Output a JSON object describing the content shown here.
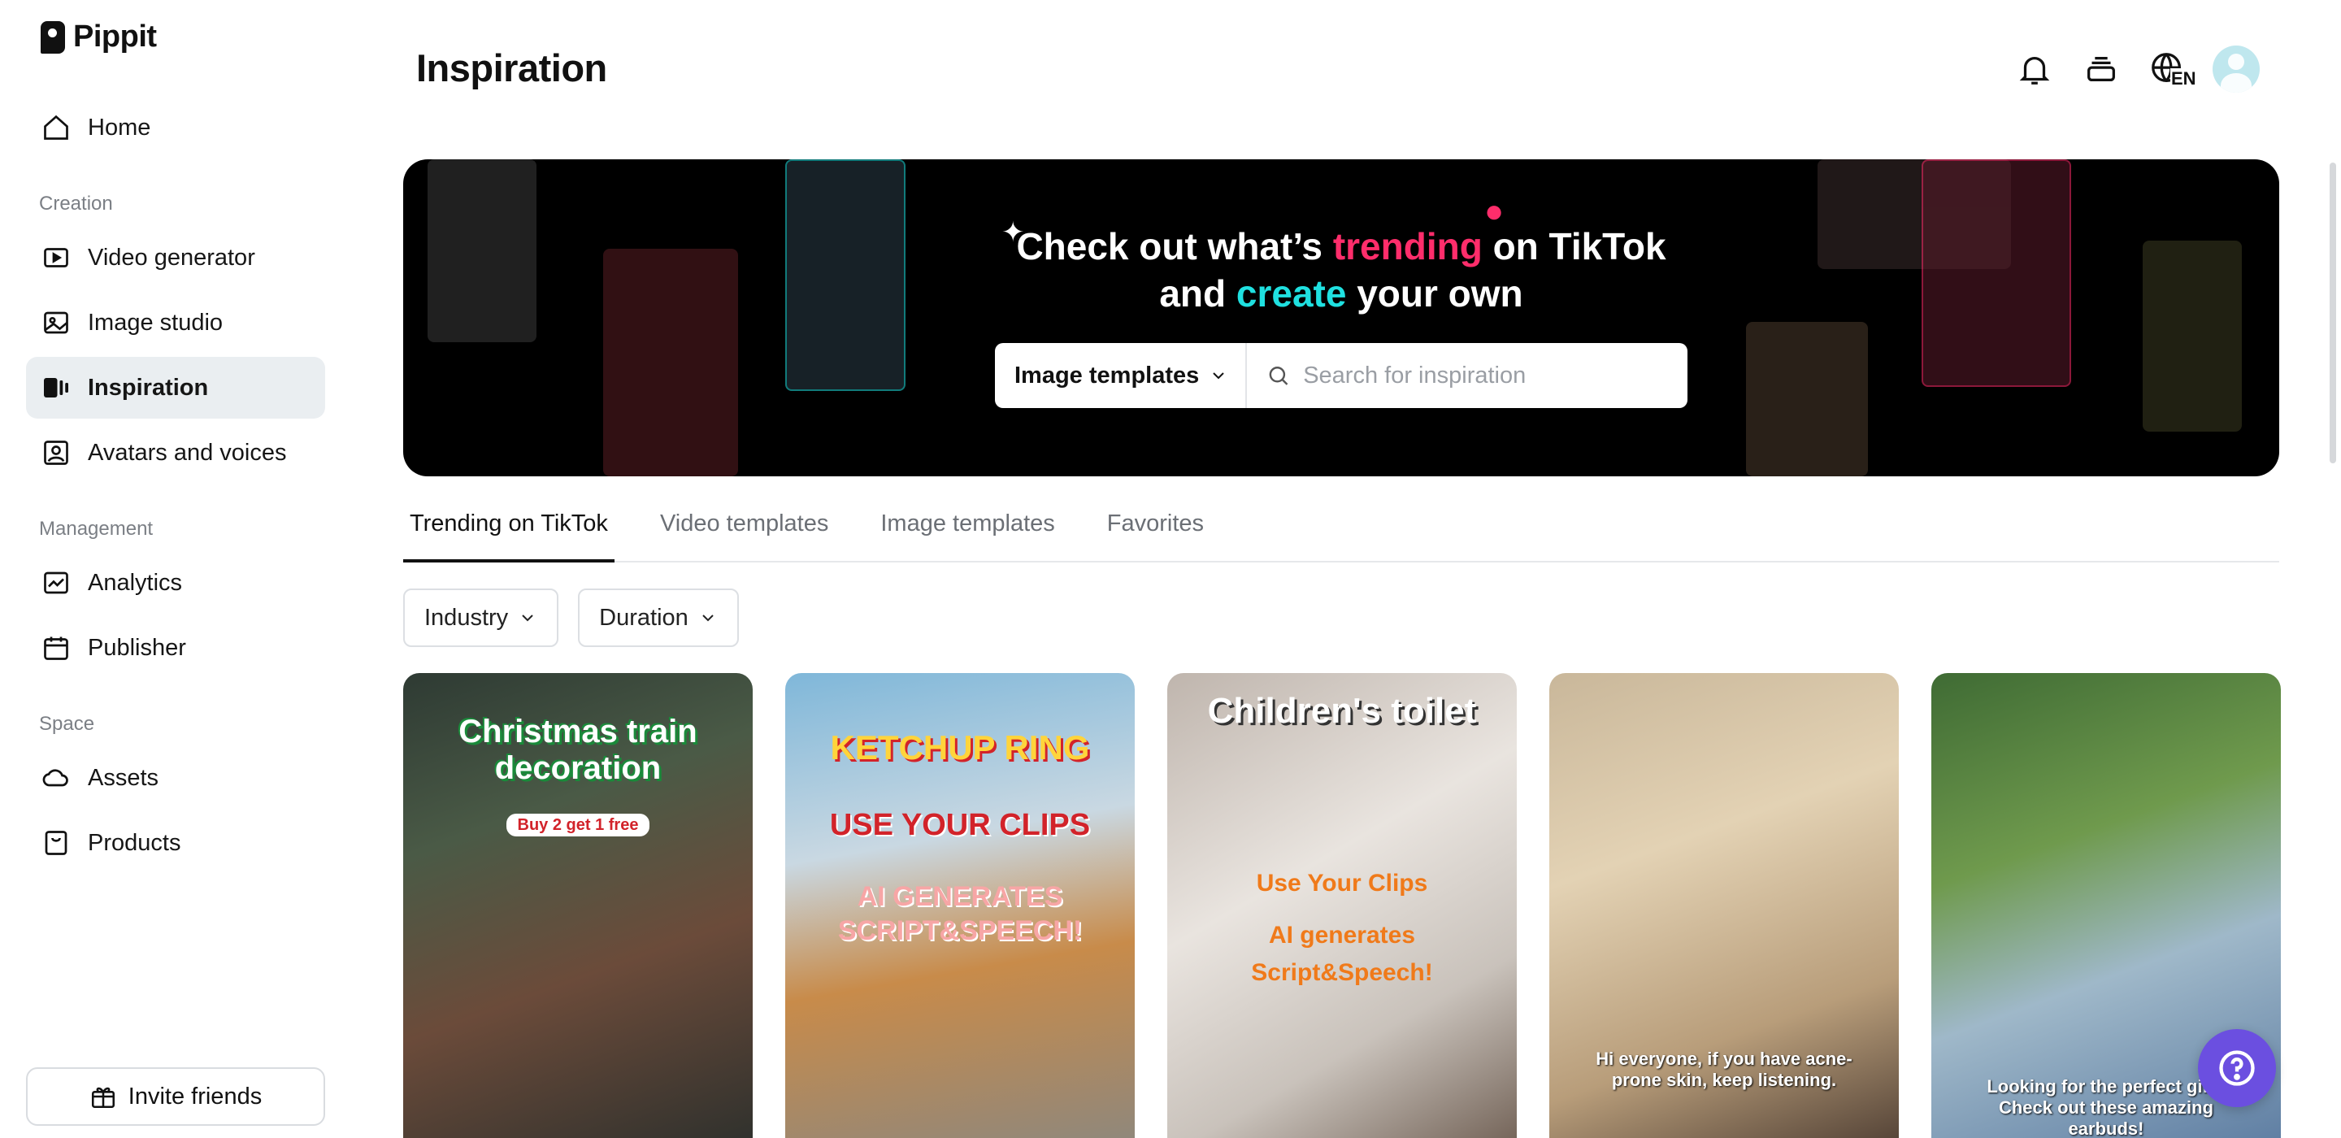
{
  "app": {
    "name": "Pippit"
  },
  "sidebar": {
    "items_top": [
      {
        "label": "Home",
        "icon": "home-icon"
      }
    ],
    "sections": [
      {
        "label": "Creation",
        "items": [
          {
            "label": "Video generator",
            "icon": "video-generator-icon"
          },
          {
            "label": "Image studio",
            "icon": "image-studio-icon"
          },
          {
            "label": "Inspiration",
            "icon": "inspiration-icon",
            "active": true
          },
          {
            "label": "Avatars and voices",
            "icon": "avatar-icon"
          }
        ]
      },
      {
        "label": "Management",
        "items": [
          {
            "label": "Analytics",
            "icon": "analytics-icon"
          },
          {
            "label": "Publisher",
            "icon": "calendar-icon"
          }
        ]
      },
      {
        "label": "Space",
        "items": [
          {
            "label": "Assets",
            "icon": "cloud-icon"
          },
          {
            "label": "Products",
            "icon": "product-box-icon"
          }
        ]
      }
    ],
    "invite_label": "Invite friends"
  },
  "header": {
    "title": "Inspiration",
    "icons": [
      "bell-icon",
      "layers-icon",
      "language-icon",
      "avatar"
    ],
    "language_code": "EN"
  },
  "banner": {
    "line1_pre": "Check out what’s ",
    "line1_highlight": "trending",
    "line1_post": " on TikTok",
    "line2_pre": "and ",
    "line2_highlight": "create",
    "line2_post": " your own",
    "select_label": "Image templates",
    "search_placeholder": "Search for inspiration",
    "colors": {
      "pink": "#ff2d6b",
      "cyan": "#1fe0e0"
    }
  },
  "tabs": [
    {
      "label": "Trending on TikTok",
      "active": true
    },
    {
      "label": "Video templates"
    },
    {
      "label": "Image templates"
    },
    {
      "label": "Favorites"
    }
  ],
  "filters": [
    {
      "label": "Industry"
    },
    {
      "label": "Duration"
    }
  ],
  "cards": [
    {
      "title": "Christmas train decoration",
      "subtitle": "Buy 2 get 1 free"
    },
    {
      "title": "KETCHUP RING",
      "line2": "USE YOUR CLIPS",
      "line3": "AI GENERATES SCRIPT&SPEECH!"
    },
    {
      "title": "Children's toilet",
      "line2": "Use Your Clips",
      "line3": "AI generates Script&Speech!"
    },
    {
      "caption": "Hi everyone, if you have acne-prone skin, keep listening."
    },
    {
      "caption": "Looking for the perfect gift? Check out these amazing earbuds!"
    }
  ]
}
